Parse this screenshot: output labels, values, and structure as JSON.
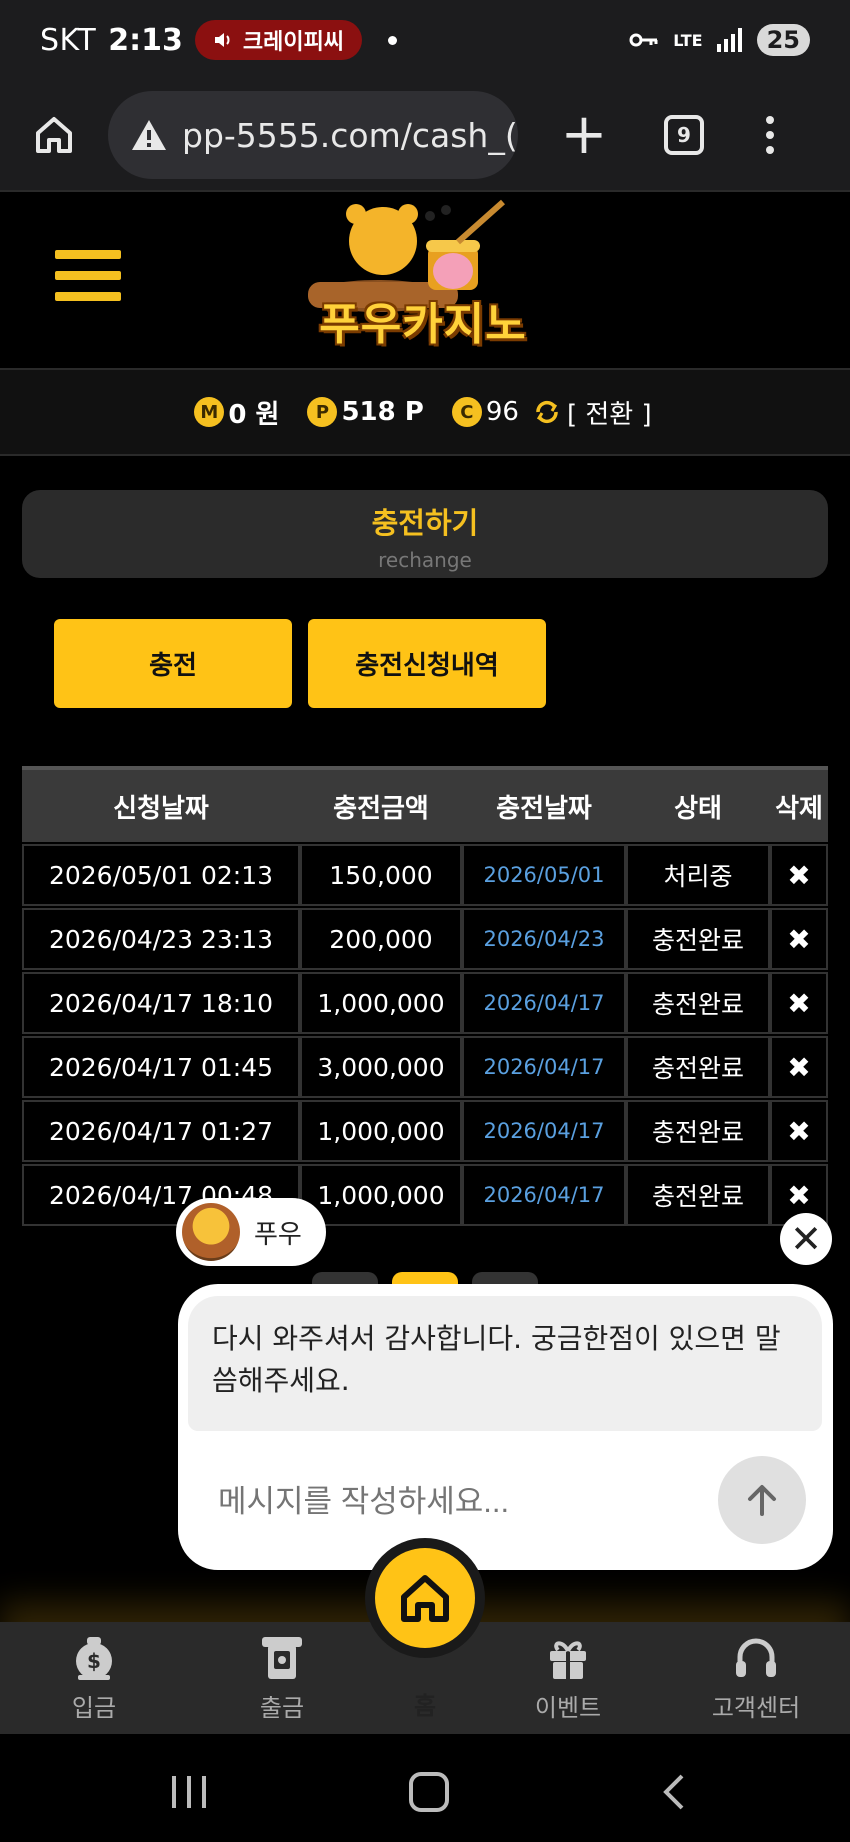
{
  "status_bar": {
    "carrier": "SKT",
    "time": "2:13",
    "recording_label": "크레이피씨",
    "network": "LTE",
    "battery": "25"
  },
  "browser": {
    "url": "pp-5555.com/cash_(",
    "tab_count": "9"
  },
  "site": {
    "logo_text": "푸우카지노"
  },
  "balance": {
    "m_icon": "M",
    "money": "0 원",
    "p_icon": "P",
    "points": "518 P",
    "c_icon": "C",
    "coins": "96",
    "switch_label": "[ 전환 ]"
  },
  "page_title": {
    "ko": "충전하기",
    "en": "rechange"
  },
  "buttons": {
    "charge": "충전",
    "history": "충전신청내역"
  },
  "table": {
    "headers": [
      "신청날짜",
      "충전금액",
      "충전날짜",
      "상태",
      "삭제"
    ],
    "rows": [
      {
        "request_date": "2026/05/01 02:13",
        "amount": "150,000",
        "charge_date": "2026/05/01",
        "status": "처리중",
        "delete": "✖"
      },
      {
        "request_date": "2026/04/23 23:13",
        "amount": "200,000",
        "charge_date": "2026/04/23",
        "status": "충전완료",
        "delete": "✖"
      },
      {
        "request_date": "2026/04/17 18:10",
        "amount": "1,000,000",
        "charge_date": "2026/04/17",
        "status": "충전완료",
        "delete": "✖"
      },
      {
        "request_date": "2026/04/17 01:45",
        "amount": "3,000,000",
        "charge_date": "2026/04/17",
        "status": "충전완료",
        "delete": "✖"
      },
      {
        "request_date": "2026/04/17 01:27",
        "amount": "1,000,000",
        "charge_date": "2026/04/17",
        "status": "충전완료",
        "delete": "✖"
      },
      {
        "request_date": "2026/04/17 00:48",
        "amount": "1,000,000",
        "charge_date": "2026/04/17",
        "status": "충전완료",
        "delete": "✖"
      }
    ]
  },
  "chat": {
    "agent_name": "푸우",
    "close_symbol": "✕",
    "message": "다시 와주셔서 감사합니다. 궁금한점이 있으면 말씀해주세요.",
    "input_placeholder": "메시지를 작성하세요..."
  },
  "bottom_nav": {
    "deposit": "입금",
    "withdraw": "출금",
    "home": "홈",
    "event": "이벤트",
    "support": "고객센터"
  },
  "colors": {
    "accent": "#ffc316",
    "link_blue": "#5aa0e0",
    "background": "#000000"
  }
}
